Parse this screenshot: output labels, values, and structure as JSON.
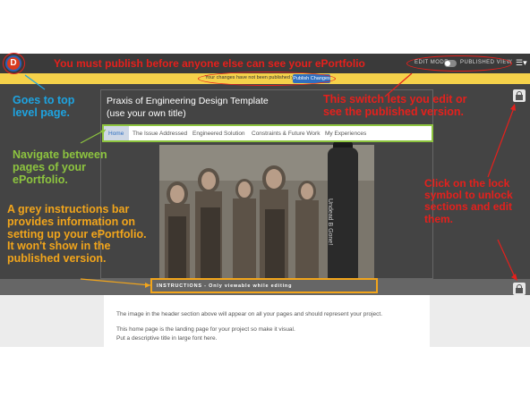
{
  "app": {
    "logo_letter": "D",
    "edit_mode": "EDIT MODE",
    "published_view": "PUBLISHED VIEW",
    "menu_icon": "hamburger-icon"
  },
  "notice": {
    "text": "Your changes have not been published yet.",
    "publish_button": "Publish Changes"
  },
  "header": {
    "title_line1": "Praxis of Engineering Design Template",
    "title_line2": "(use your own title)"
  },
  "nav": {
    "tabs": [
      {
        "label": "Home"
      },
      {
        "label": "The Issue Addressed"
      },
      {
        "label": "Engineered Solution"
      },
      {
        "label": "Constraints & Future Work"
      },
      {
        "label": "My Experiences"
      }
    ]
  },
  "hero": {
    "spray_text": "Undead B Gone!"
  },
  "instructions": {
    "text": "INSTRUCTIONS - Only viewable while editing"
  },
  "content": {
    "line1": "The image in the header section above will appear on all your pages and should represent your project.",
    "line2": "This home page is the landing page for your project so make it visual.",
    "line3": "Put a descriptive title in large font here."
  },
  "annotations": {
    "publish": "You must publish before anyone else can see your ePortfolio",
    "top_level": [
      "Goes to top",
      "level page."
    ],
    "switch": [
      "This switch lets you edit or",
      "see the published version."
    ],
    "navigate": [
      "Navigate between",
      "pages of your",
      "ePortfolio."
    ],
    "grey_bar": [
      "A grey instructions bar",
      "provides information on",
      "setting up your ePortfolio.",
      "It won't show in the",
      "published version."
    ],
    "lock": [
      "Click on the lock",
      "symbol to unlock",
      "sections and edit",
      "them."
    ]
  },
  "colors": {
    "annotation_red": "#e5201c",
    "annotation_blue": "#1ea3e0",
    "annotation_green": "#8dc43f",
    "annotation_orange": "#f2a51b",
    "notice_yellow": "#f5d14a",
    "publish_blue": "#2f6fc0"
  }
}
